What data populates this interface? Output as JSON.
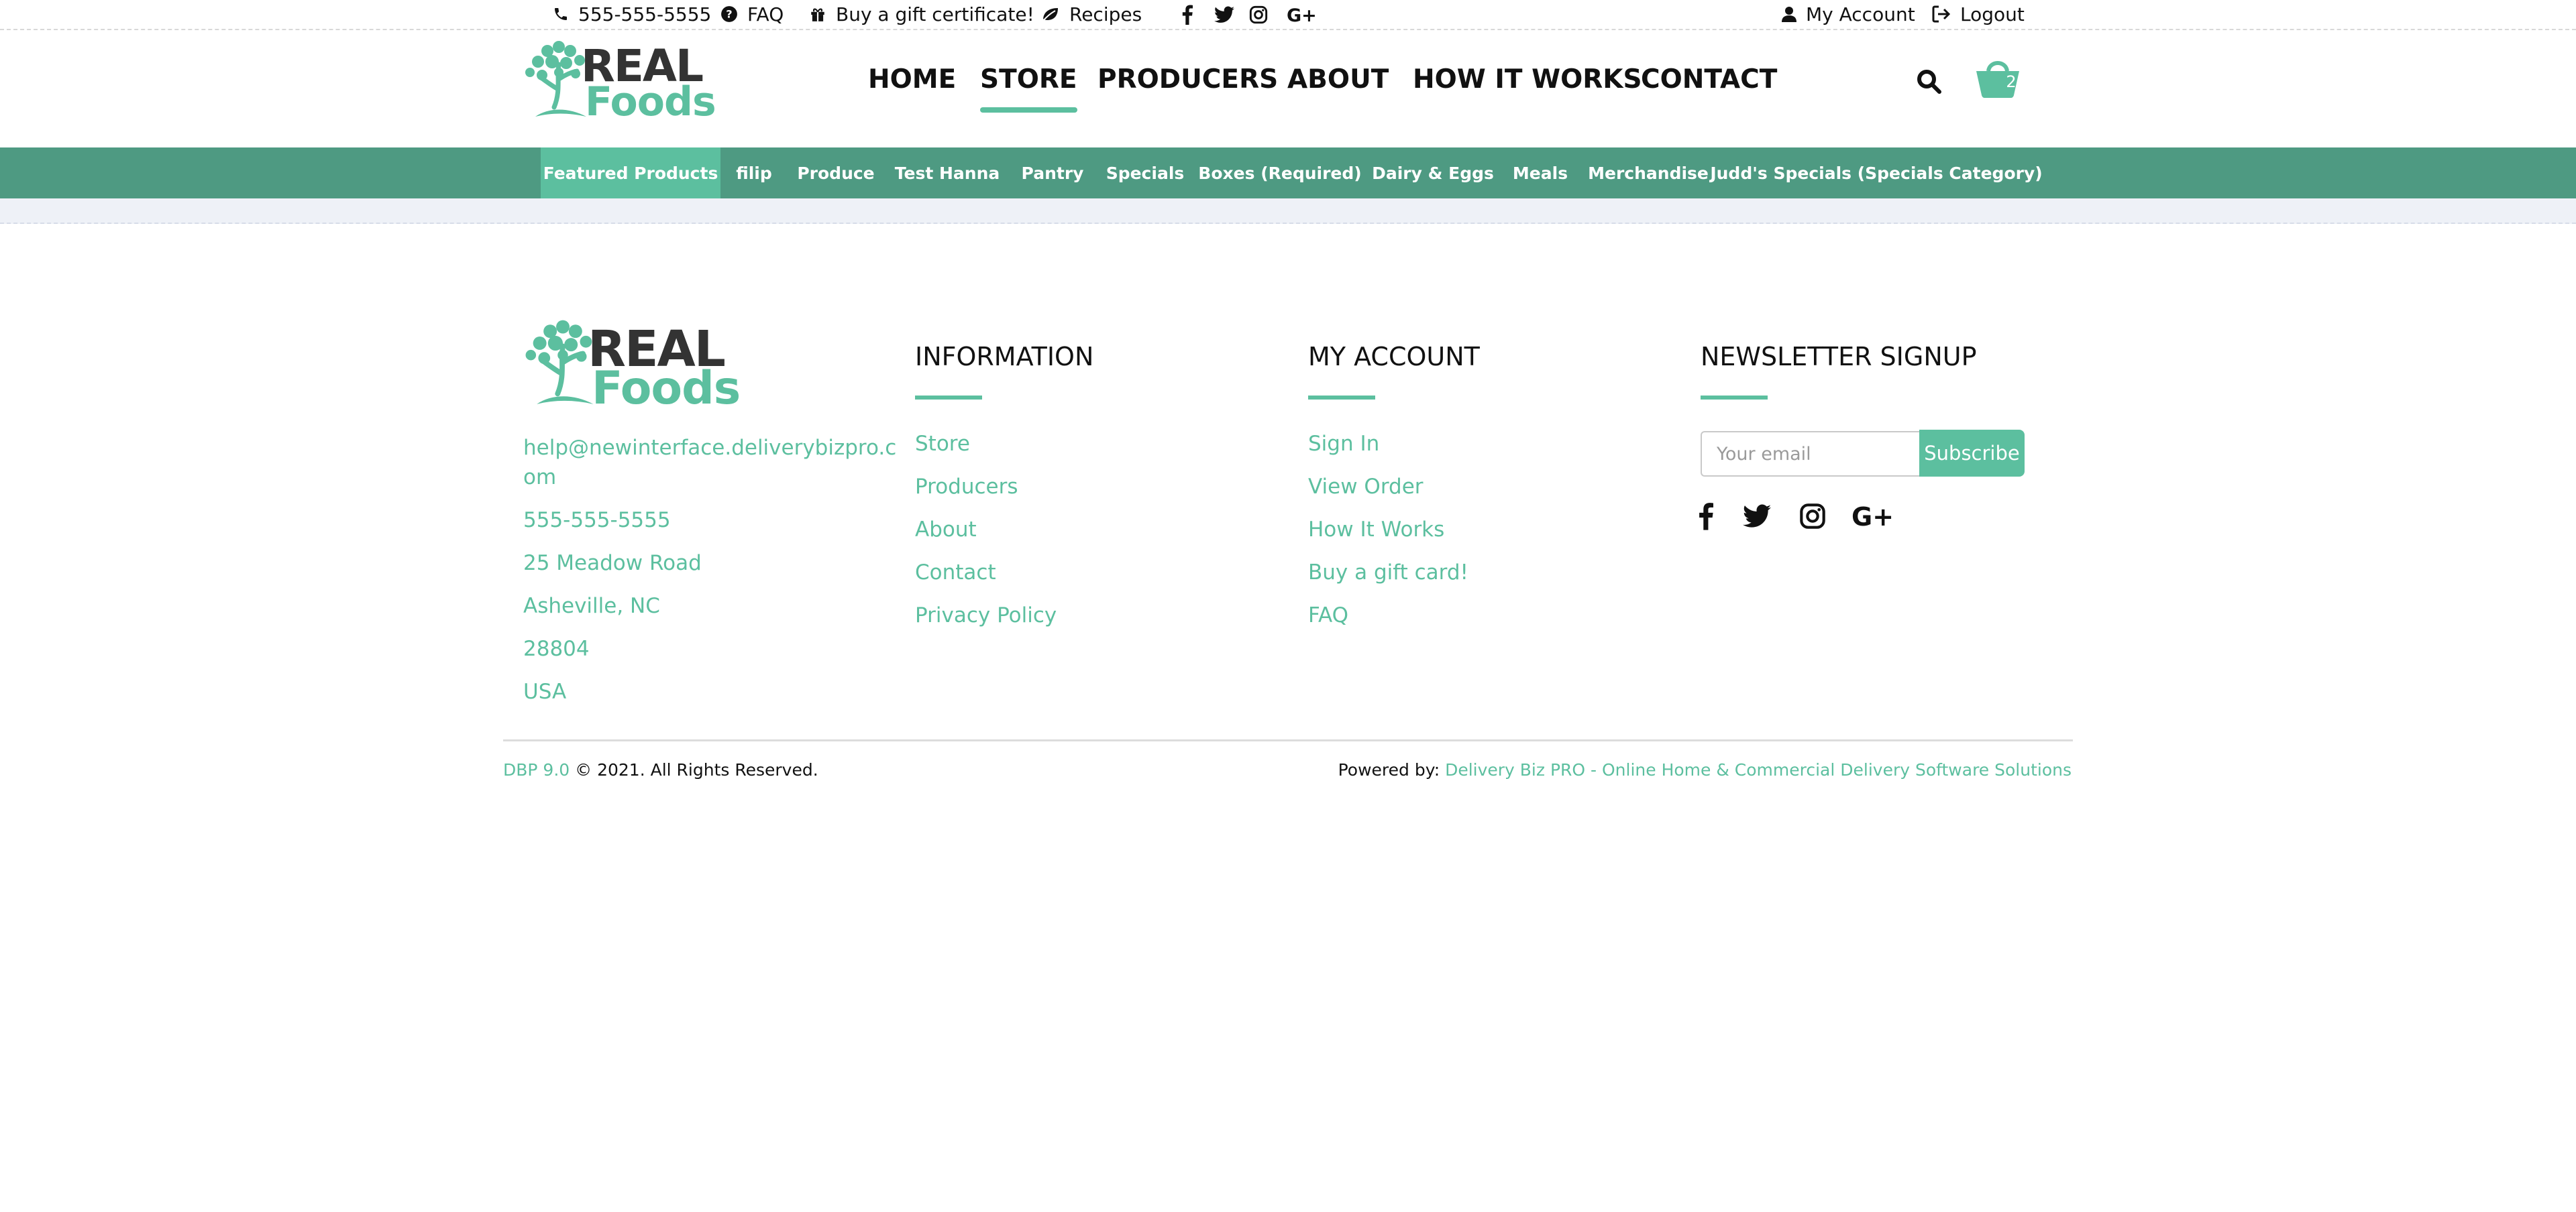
{
  "topbar": {
    "phone": "555-555-5555",
    "faq": "FAQ",
    "gift": "Buy a gift certificate!",
    "recipes": "Recipes",
    "social": [
      "facebook-icon",
      "twitter-icon",
      "instagram-icon",
      "google-plus-icon"
    ],
    "my_account": "My Account",
    "logout": "Logout"
  },
  "brand": {
    "logo_word1": "REAL",
    "logo_word2": "Foods",
    "accent_color": "#5cbf9f",
    "bar_color": "#4e9a82"
  },
  "nav": {
    "items": [
      "HOME",
      "STORE",
      "PRODUCERS",
      "ABOUT",
      "HOW IT WORKS",
      "CONTACT"
    ],
    "active": "STORE",
    "cart_count": "2"
  },
  "categories": {
    "items": [
      "Featured Products",
      "filip",
      "Produce",
      "Test Hanna",
      "Pantry",
      "Specials",
      "Boxes (Required)",
      "Dairy & Eggs",
      "Meals",
      "Merchandise",
      "Judd's Specials (Specials Category)"
    ],
    "active": "Featured Products"
  },
  "footer": {
    "contact": {
      "email_line1": "help@newinterface.deliverybizpro.c",
      "email_line2": "om",
      "phone": "555-555-5555",
      "street": "25 Meadow Road",
      "city": "Asheville, NC",
      "zip": "28804",
      "country": "USA"
    },
    "information": {
      "title": "INFORMATION",
      "links": [
        "Store",
        "Producers",
        "About",
        "Contact",
        "Privacy Policy"
      ]
    },
    "my_account": {
      "title": "MY ACCOUNT",
      "links": [
        "Sign In",
        "View Order",
        "How It Works",
        "Buy a gift card!",
        "FAQ"
      ]
    },
    "newsletter": {
      "title": "NEWSLETTER SIGNUP",
      "placeholder": "Your email",
      "button": "Subscribe"
    },
    "version": "DBP 9.0",
    "copyright": " © 2021. All Rights Reserved.",
    "powered_label": "Powered by: ",
    "powered_link": "Delivery Biz PRO - Online Home & Commercial Delivery Software Solutions"
  }
}
